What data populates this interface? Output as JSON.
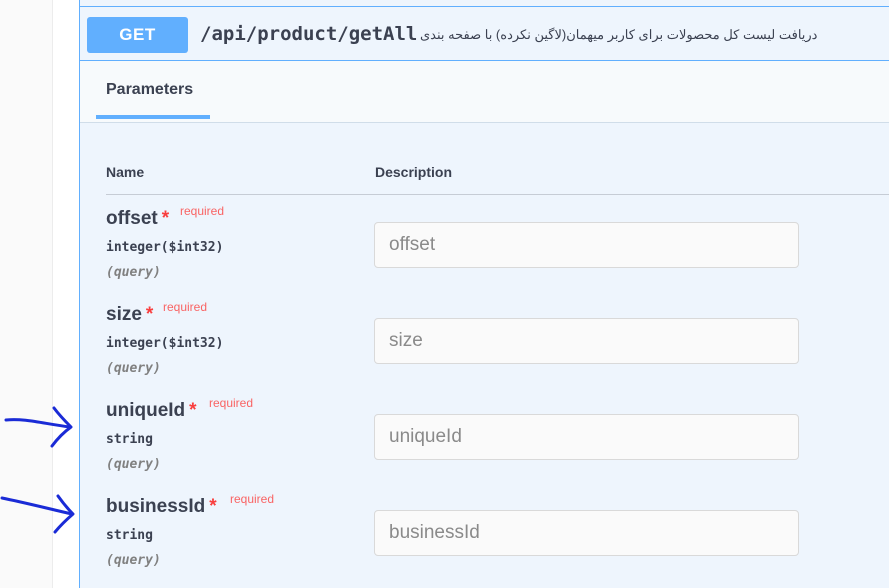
{
  "operation": {
    "method": "GET",
    "path": "/api/product/getAll",
    "description": "دریافت لیست کل محصولات برای کاربر میهمان(لاگین نکرده) با صفحه بندی"
  },
  "tabs": {
    "parameters": "Parameters"
  },
  "table": {
    "name_header": "Name",
    "description_header": "Description"
  },
  "parameters": [
    {
      "name": "offset",
      "required_mark": "*",
      "required_label": "required",
      "type": "integer($int32)",
      "in": "(query)",
      "placeholder": "offset"
    },
    {
      "name": "size",
      "required_mark": "*",
      "required_label": "required",
      "type": "integer($int32)",
      "in": "(query)",
      "placeholder": "size"
    },
    {
      "name": "uniqueId",
      "required_mark": "*",
      "required_label": "required",
      "type": "string",
      "in": "(query)",
      "placeholder": "uniqueId"
    },
    {
      "name": "businessId",
      "required_mark": "*",
      "required_label": "required",
      "type": "string",
      "in": "(query)",
      "placeholder": "businessId"
    }
  ],
  "colors": {
    "get_blue": "#61affe",
    "required_red": "#f93e3e",
    "annotation_ink": "#1a2bd6"
  }
}
